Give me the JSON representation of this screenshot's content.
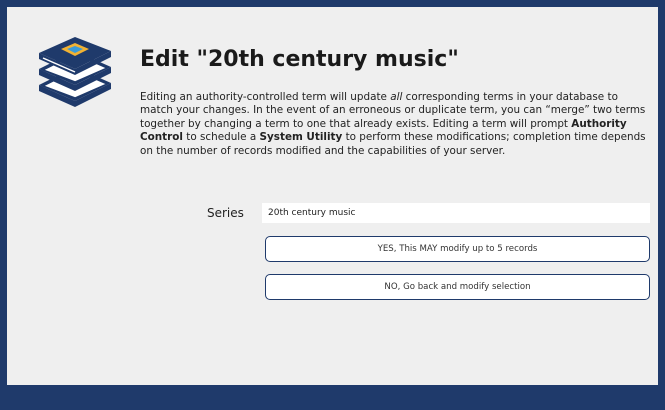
{
  "dialog": {
    "title": "Edit \"20th century music\"",
    "description": {
      "part1": "Editing an authority-controlled term will update ",
      "emph": "all",
      "part2": " corresponding terms in your database to match your changes. In the event of an erroneous or duplicate term, you can “merge” two terms together by changing a term to one that already exists. Editing a term will prompt ",
      "bold1": "Authority Control",
      "part3": " to schedule a ",
      "bold2": "System Utility",
      "part4": " to perform these modifications; completion time depends on the number of records modified and the capabilities of your server."
    }
  },
  "form": {
    "series_label": "Series",
    "series_value": "20th century music"
  },
  "buttons": {
    "confirm_label": "YES, This MAY modify up to 5 records",
    "cancel_label": "NO, Go back and modify selection"
  },
  "icons": {
    "header_icon": "books-stack-icon"
  },
  "colors": {
    "accent": "#1f3a6b",
    "panel_background": "#efefef"
  }
}
